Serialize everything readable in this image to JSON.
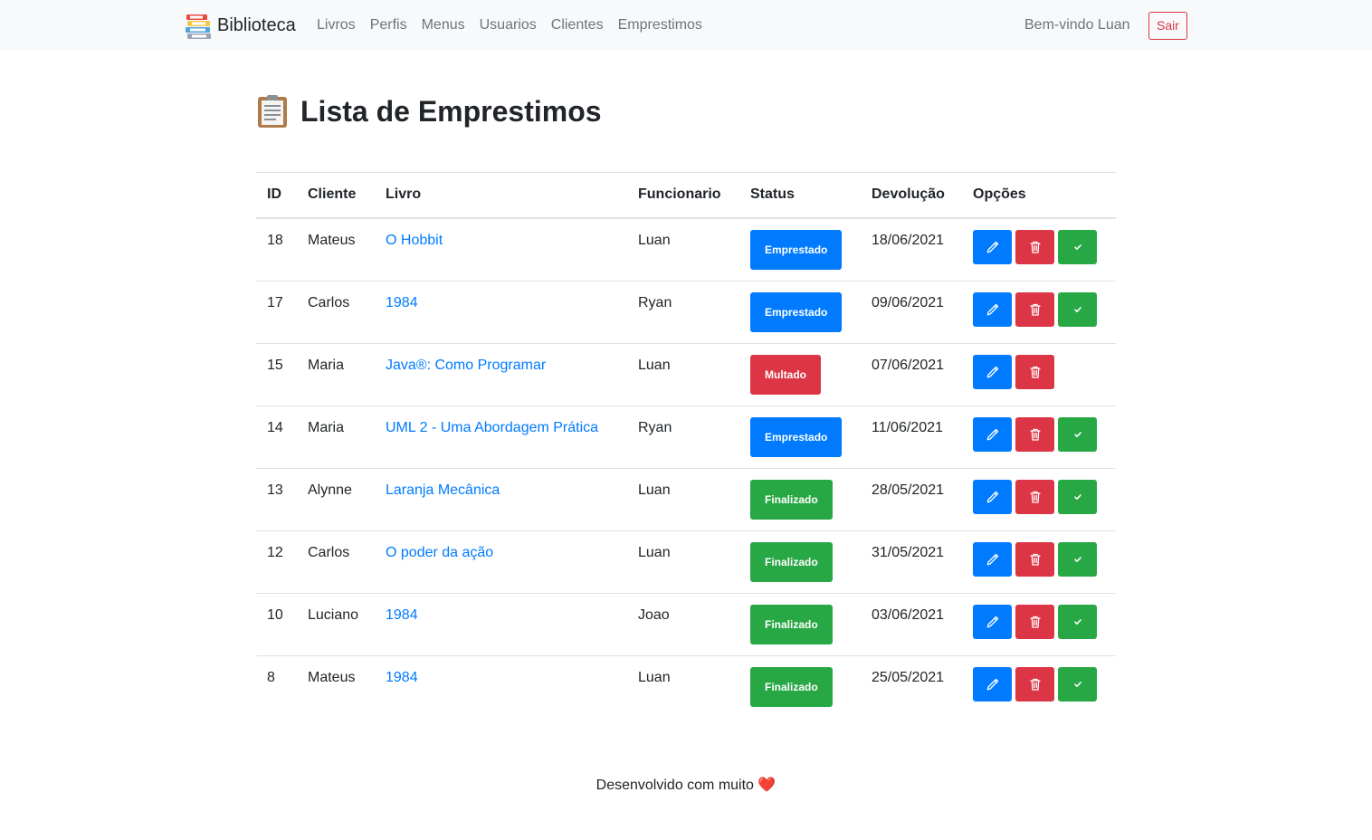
{
  "navbar": {
    "brand": "Biblioteca",
    "links": [
      "Livros",
      "Perfis",
      "Menus",
      "Usuarios",
      "Clientes",
      "Emprestimos"
    ],
    "welcome": "Bem-vindo Luan",
    "logout": "Sair"
  },
  "page": {
    "title": "Lista de Emprestimos"
  },
  "table": {
    "headers": [
      "ID",
      "Cliente",
      "Livro",
      "Funcionario",
      "Status",
      "Devolução",
      "Opções"
    ],
    "rows": [
      {
        "id": "18",
        "cliente": "Mateus",
        "livro": "O Hobbit",
        "funcionario": "Luan",
        "status": "Emprestado",
        "devolucao": "18/06/2021",
        "finalize": true
      },
      {
        "id": "17",
        "cliente": "Carlos",
        "livro": "1984",
        "funcionario": "Ryan",
        "status": "Emprestado",
        "devolucao": "09/06/2021",
        "finalize": true
      },
      {
        "id": "15",
        "cliente": "Maria",
        "livro": "Java®: Como Programar",
        "funcionario": "Luan",
        "status": "Multado",
        "devolucao": "07/06/2021",
        "finalize": false
      },
      {
        "id": "14",
        "cliente": "Maria",
        "livro": "UML 2 - Uma Abordagem Prática",
        "funcionario": "Ryan",
        "status": "Emprestado",
        "devolucao": "11/06/2021",
        "finalize": true
      },
      {
        "id": "13",
        "cliente": "Alynne",
        "livro": "Laranja Mecânica",
        "funcionario": "Luan",
        "status": "Finalizado",
        "devolucao": "28/05/2021",
        "finalize": true
      },
      {
        "id": "12",
        "cliente": "Carlos",
        "livro": "O poder da ação",
        "funcionario": "Luan",
        "status": "Finalizado",
        "devolucao": "31/05/2021",
        "finalize": true
      },
      {
        "id": "10",
        "cliente": "Luciano",
        "livro": "1984",
        "funcionario": "Joao",
        "status": "Finalizado",
        "devolucao": "03/06/2021",
        "finalize": true
      },
      {
        "id": "8",
        "cliente": "Mateus",
        "livro": "1984",
        "funcionario": "Luan",
        "status": "Finalizado",
        "devolucao": "25/05/2021",
        "finalize": true
      }
    ]
  },
  "status_colors": {
    "Emprestado": "#007bff",
    "Multado": "#dc3545",
    "Finalizado": "#28a745"
  },
  "icons": {
    "brand": "books-icon",
    "title": "clipboard-icon",
    "edit": "pencil-icon",
    "delete": "trash-icon",
    "finalize": "check-icon",
    "footer": "heart-icon"
  },
  "footer": {
    "text": "Desenvolvido com muito",
    "heart": "❤️"
  }
}
